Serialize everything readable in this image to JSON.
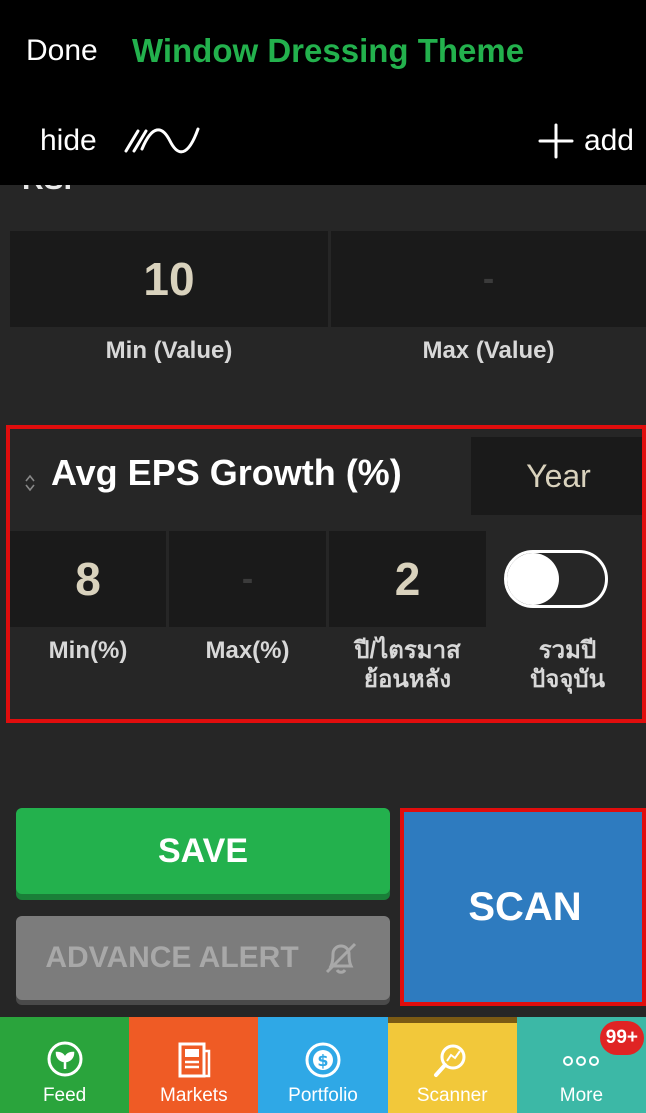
{
  "header": {
    "done_label": "Done",
    "title": "Window Dressing Theme",
    "hide_label": "hide",
    "add_label": "add"
  },
  "rsi": {
    "cut_label": "RSI",
    "min_value": "10",
    "max_value": "-",
    "min_label": "Min (Value)",
    "max_label": "Max (Value)"
  },
  "eps": {
    "title": "Avg EPS Growth (%)",
    "period": "Year",
    "min_value": "8",
    "max_value": "-",
    "years_value": "2",
    "min_label": "Min(%)",
    "max_label": "Max(%)",
    "years_label_line1": "ปี/ไตรมาส",
    "years_label_line2": "ย้อนหลัง",
    "include_label_line1": "รวมปี",
    "include_label_line2": "ปัจจุบัน",
    "include_current": false
  },
  "actions": {
    "save_label": "SAVE",
    "alert_label": "ADVANCE ALERT",
    "scan_label": "SCAN"
  },
  "tabbar": {
    "tabs": [
      {
        "label": "Feed",
        "icon": "feed-icon",
        "color": "#2aa43c"
      },
      {
        "label": "Markets",
        "icon": "markets-icon",
        "color": "#ef5b25"
      },
      {
        "label": "Portfolio",
        "icon": "portfolio-icon",
        "color": "#2fa8e6"
      },
      {
        "label": "Scanner",
        "icon": "scanner-icon",
        "color": "#f2c83a",
        "active": true
      },
      {
        "label": "More",
        "icon": "more-icon",
        "color": "#3cb8a6",
        "badge": "99+"
      }
    ]
  },
  "colors": {
    "accent_green": "#23b14d",
    "scan_blue": "#2e7bbf",
    "highlight_red": "#e00d0d"
  }
}
